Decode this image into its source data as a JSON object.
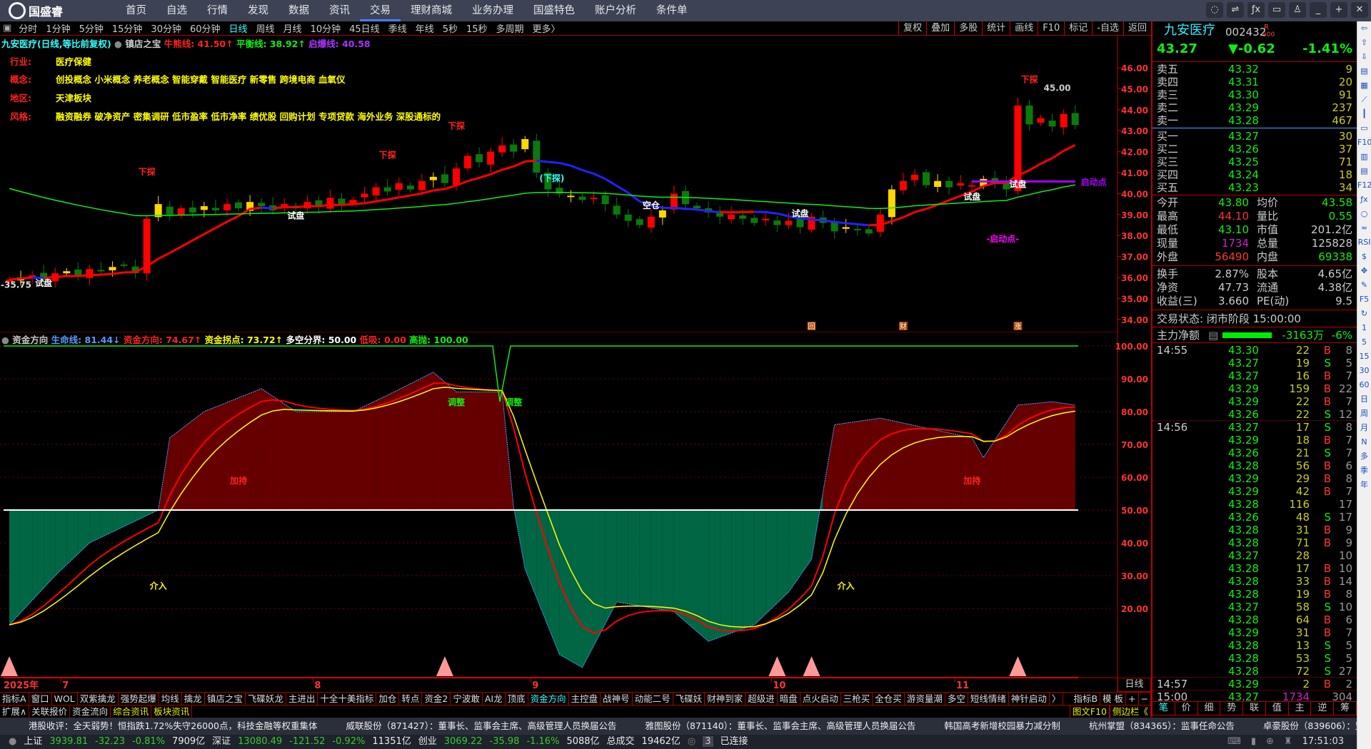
{
  "app": {
    "logo_text": "国盛睿"
  },
  "nav": [
    "首页",
    "自选",
    "行情",
    "发现",
    "数据",
    "资讯",
    "交易",
    "理财商城",
    "业务办理",
    "国盛特色",
    "账户分析",
    "条件单"
  ],
  "nav_active": 6,
  "window_buttons": [
    "chat-icon",
    "settings-icon",
    "fx-icon",
    "screen-icon",
    "skin-icon",
    "minimize-icon",
    "restore-icon",
    "close-icon"
  ],
  "periods": [
    "分时",
    "1分钟",
    "5分钟",
    "15分钟",
    "30分钟",
    "60分钟",
    "日线",
    "周线",
    "月线",
    "10分钟",
    "45日线",
    "季线",
    "年线",
    "5秒",
    "15秒",
    "多周期",
    "更多〉"
  ],
  "period_active": 6,
  "chart_tools": [
    "复权",
    "叠加",
    "多股",
    "统计",
    "画线",
    "F10",
    "标记",
    "-自选",
    "返回"
  ],
  "main_header": {
    "title": "九安医疗(日线,等比前复权)",
    "indicator": "镇店之宝",
    "bull_label": "牛熊线: 41.50↑",
    "balance_label": "平衡线: 38.92↑",
    "burst_label": "启爆线: 40.58"
  },
  "info": [
    {
      "k": "行业:",
      "v": "医疗保健"
    },
    {
      "k": "概念:",
      "v": "创投概念 小米概念 养老概念 智能穿戴 智能医疗 新零售 跨境电商 血氧仪"
    },
    {
      "k": "地区:",
      "v": "天津板块"
    },
    {
      "k": "风格:",
      "v": "融资融券 破净资产 密集调研 低市盈率 低市净率 绩优股 回购计划 专项贷款 海外业务 深股通标的"
    }
  ],
  "price_axis": [
    "46.00",
    "45.00",
    "44.00",
    "43.00",
    "42.00",
    "41.00",
    "40.00",
    "39.00",
    "38.00",
    "37.00",
    "36.00",
    "35.00",
    "34.00"
  ],
  "chart_data": {
    "type": "candlestick",
    "closes": [
      35.9,
      36.0,
      36.1,
      35.9,
      36.2,
      36.3,
      36.1,
      36.4,
      36.3,
      36.5,
      36.6,
      36.2,
      38.8,
      39.5,
      39.0,
      39.3,
      39.1,
      39.4,
      39.2,
      39.5,
      39.3,
      39.6,
      39.4,
      39.2,
      39.5,
      39.3,
      39.6,
      39.4,
      39.8,
      39.5,
      39.7,
      40.0,
      40.3,
      40.1,
      40.5,
      40.2,
      40.6,
      40.8,
      40.5,
      41.2,
      41.8,
      41.5,
      42.0,
      42.3,
      42.0,
      42.6,
      41.0,
      40.2,
      40.0,
      39.9,
      39.7,
      39.8,
      39.5,
      39.0,
      38.7,
      38.5,
      38.9,
      39.2,
      40.0,
      39.5,
      39.3,
      39.1,
      38.9,
      39.0,
      38.8,
      38.6,
      38.8,
      38.5,
      38.7,
      38.4,
      38.9,
      38.6,
      38.2,
      38.4,
      38.3,
      38.1,
      39.0,
      40.2,
      40.6,
      40.9,
      40.4,
      40.6,
      40.3,
      40.5,
      40.4,
      40.7,
      40.5,
      40.2,
      44.2,
      43.3,
      43.6,
      43.2,
      43.8,
      43.27
    ],
    "first_open": 35.8,
    "price_range": [
      33.6,
      46.4
    ],
    "launch_line": {
      "value": 40.58,
      "from": 84,
      "to": 93,
      "label": "启动点"
    },
    "annotations": [
      {
        "i": 0,
        "p": 35.5,
        "t": "-35.75",
        "c": "#ddd"
      },
      {
        "i": 3,
        "p": 35.6,
        "t": "试盘",
        "c": "#fff"
      },
      {
        "i": 12,
        "p": 40.9,
        "t": "下探",
        "c": "#f22"
      },
      {
        "i": 25,
        "p": 38.8,
        "t": "试盘",
        "c": "#fff"
      },
      {
        "i": 33,
        "p": 41.7,
        "t": "下探",
        "c": "#f22"
      },
      {
        "i": 39,
        "p": 43.1,
        "t": "下探",
        "c": "#f22"
      },
      {
        "i": 47,
        "p": 40.6,
        "t": "(下探)",
        "c": "#3ff"
      },
      {
        "i": 56,
        "p": 39.3,
        "t": "空仓",
        "c": "#fff"
      },
      {
        "i": 69,
        "p": 38.9,
        "t": "试盘",
        "c": "#fff"
      },
      {
        "i": 84,
        "p": 39.7,
        "t": "试盘",
        "c": "#fff"
      },
      {
        "i": 88,
        "p": 40.3,
        "t": "试盘",
        "c": "#fff"
      },
      {
        "i": 89,
        "p": 45.3,
        "t": "下探",
        "c": "#f22"
      },
      {
        "i": 91,
        "p": 44.9,
        "t": "45.00",
        "c": "#ccc"
      },
      {
        "i": 86,
        "p": 37.7,
        "t": "-启动点-",
        "c": "#f0f"
      }
    ],
    "event_markers": [
      {
        "i": 70,
        "t": "回"
      },
      {
        "i": 78,
        "t": "财"
      },
      {
        "i": 88,
        "t": "涨"
      }
    ]
  },
  "indicator": {
    "name": "资金方向",
    "life_label": "生命线: 81.44↓",
    "dir_label": "资金方向: 74.67↑",
    "turn_label": "资金拐点: 73.72↑",
    "split_label": "多空分界: 50.00",
    "low_label": "低吸: 0.00",
    "high_label": "高抛: 100.00",
    "axis": [
      "100.00",
      "90.00",
      "80.00",
      "70.00",
      "60.00",
      "50.00",
      "40.00",
      "30.00",
      "20.00"
    ],
    "fund_keyframes": [
      [
        0,
        15
      ],
      [
        4,
        30
      ],
      [
        7,
        40
      ],
      [
        13,
        50
      ],
      [
        14,
        72
      ],
      [
        17,
        80
      ],
      [
        22,
        87
      ],
      [
        25,
        80
      ],
      [
        30,
        80
      ],
      [
        33,
        85
      ],
      [
        37,
        92
      ],
      [
        39,
        86
      ],
      [
        43,
        86
      ],
      [
        44,
        51
      ],
      [
        45,
        32
      ],
      [
        48,
        6
      ],
      [
        50,
        2
      ],
      [
        53,
        22
      ],
      [
        58,
        19
      ],
      [
        61,
        10
      ],
      [
        65,
        15
      ],
      [
        68,
        25
      ],
      [
        70,
        35
      ],
      [
        72,
        76
      ],
      [
        76,
        78
      ],
      [
        80,
        75
      ],
      [
        84,
        72
      ],
      [
        85,
        66
      ],
      [
        88,
        82
      ],
      [
        91,
        83
      ],
      [
        93,
        82
      ]
    ],
    "signals": [
      {
        "i": 13,
        "v": 26,
        "t": "介入"
      },
      {
        "i": 20,
        "v": 58,
        "t": "加持"
      },
      {
        "i": 39,
        "v": 82,
        "t": "调整"
      },
      {
        "i": 44,
        "v": 82,
        "t": "调整"
      },
      {
        "i": 73,
        "v": 26,
        "t": "介入"
      },
      {
        "i": 84,
        "v": 58,
        "t": "加持"
      }
    ],
    "triangles": [
      0,
      38,
      67,
      70,
      88
    ]
  },
  "date_axis": [
    {
      "i": 0,
      "t": "2025年"
    },
    {
      "i": 5,
      "t": "7"
    },
    {
      "i": 27,
      "t": "8"
    },
    {
      "i": 46,
      "t": "9"
    },
    {
      "i": 67,
      "t": "10"
    },
    {
      "i": 83,
      "t": "11"
    }
  ],
  "period_box": "日线",
  "indicator_tabs": [
    "指标A",
    "窗口",
    "WOL",
    "双紫擒龙",
    "强势起爆",
    "均线",
    "擒龙",
    "镇店之宝",
    "飞碟妖龙",
    "主进出",
    "十全十美指标",
    "加仓",
    "转点",
    "资金2",
    "宁波敢",
    "AI龙",
    "顶底",
    "资金方向",
    "主控盘",
    "战神号",
    "动能二号",
    "飞碟妖",
    "财神到家",
    "超级进",
    "暗盘",
    "点火启动",
    "三枪买",
    "全仓买",
    "游资量潮",
    "多空",
    "短线情绪",
    "神针启动",
    "〉"
  ],
  "indicator_tab_active": 17,
  "indicator_tools": [
    "指标B",
    "模 板",
    "+",
    "−"
  ],
  "ext_tabs": [
    "扩展∧",
    "关联报价",
    "资金流向",
    "综合资讯",
    "板块资讯"
  ],
  "ext_right": [
    "图文F10",
    "侧边栏《"
  ],
  "quote": {
    "name": "九安医疗",
    "code": "002432",
    "badge_top": "R",
    "badge_bottom": "500",
    "price": "43.27",
    "change": "▼-0.62",
    "pct": "-1.41%",
    "sells": [
      {
        "l": "卖五",
        "p": "43.32",
        "v": "9"
      },
      {
        "l": "卖四",
        "p": "43.31",
        "v": "20"
      },
      {
        "l": "卖三",
        "p": "43.30",
        "v": "91"
      },
      {
        "l": "卖二",
        "p": "43.29",
        "v": "237"
      },
      {
        "l": "卖一",
        "p": "43.28",
        "v": "467"
      }
    ],
    "buys": [
      {
        "l": "买一",
        "p": "43.27",
        "v": "30"
      },
      {
        "l": "买二",
        "p": "43.26",
        "v": "37"
      },
      {
        "l": "买三",
        "p": "43.25",
        "v": "71"
      },
      {
        "l": "买四",
        "p": "43.24",
        "v": "18"
      },
      {
        "l": "买五",
        "p": "43.23",
        "v": "34"
      }
    ],
    "stats": [
      {
        "k1": "今开",
        "v1": "43.80",
        "c1": "#1e1",
        "k2": "均价",
        "v2": "43.58",
        "c2": "#1e1"
      },
      {
        "k1": "最高",
        "v1": "44.10",
        "c1": "#f33",
        "k2": "量比",
        "v2": "0.55",
        "c2": "#1e1"
      },
      {
        "k1": "最低",
        "v1": "43.10",
        "c1": "#1e1",
        "k2": "市值",
        "v2": "201.2亿",
        "c2": "#ccc"
      },
      {
        "k1": "现量",
        "v1": "1734",
        "c1": "#c2c",
        "k2": "总量",
        "v2": "125828",
        "c2": "#ccc"
      },
      {
        "k1": "外盘",
        "v1": "56490",
        "c1": "#f33",
        "k2": "内盘",
        "v2": "69338",
        "c2": "#1e1"
      }
    ],
    "stats2": [
      {
        "k1": "换手",
        "v1": "2.87%",
        "k2": "股本",
        "v2": "4.65亿"
      },
      {
        "k1": "净资",
        "v1": "47.73",
        "k2": "流通",
        "v2": "4.38亿"
      },
      {
        "k1": "收益(三)",
        "v1": "3.660",
        "k2": "PE(动)",
        "v2": "9.5"
      }
    ],
    "trade_state": "交易状态: 闭市阶段 15:00:00",
    "main_flow_label": "主力净额",
    "main_flow_value": "-3163万",
    "main_flow_pct": "-6%",
    "main_flow_fill": 0.6
  },
  "trades": [
    {
      "t": "14:55",
      "p": "43.30",
      "v": "22",
      "d": "B",
      "n": "8"
    },
    {
      "t": "",
      "p": "43.27",
      "v": "19",
      "d": "S",
      "n": "5"
    },
    {
      "t": "",
      "p": "43.27",
      "v": "16",
      "d": "B",
      "n": "7"
    },
    {
      "t": "",
      "p": "43.29",
      "v": "159",
      "d": "B",
      "n": "22"
    },
    {
      "t": "",
      "p": "43.29",
      "v": "22",
      "d": "B",
      "n": "7"
    },
    {
      "t": "",
      "p": "43.26",
      "v": "22",
      "d": "S",
      "n": "12"
    },
    {
      "t": "14:56",
      "p": "43.27",
      "v": "17",
      "d": "S",
      "n": "8"
    },
    {
      "t": "",
      "p": "43.29",
      "v": "18",
      "d": "B",
      "n": "7"
    },
    {
      "t": "",
      "p": "43.26",
      "v": "21",
      "d": "S",
      "n": "7"
    },
    {
      "t": "",
      "p": "43.28",
      "v": "56",
      "d": "B",
      "n": "6"
    },
    {
      "t": "",
      "p": "43.29",
      "v": "29",
      "d": "B",
      "n": "8"
    },
    {
      "t": "",
      "p": "43.29",
      "v": "42",
      "d": "B",
      "n": "7"
    },
    {
      "t": "",
      "p": "43.28",
      "v": "116",
      "d": "",
      "n": "17"
    },
    {
      "t": "",
      "p": "43.26",
      "v": "48",
      "d": "S",
      "n": "17"
    },
    {
      "t": "",
      "p": "43.28",
      "v": "31",
      "d": "B",
      "n": "9"
    },
    {
      "t": "",
      "p": "43.28",
      "v": "71",
      "d": "B",
      "n": "9"
    },
    {
      "t": "",
      "p": "43.27",
      "v": "28",
      "d": "",
      "n": "10"
    },
    {
      "t": "",
      "p": "43.28",
      "v": "17",
      "d": "B",
      "n": "10"
    },
    {
      "t": "",
      "p": "43.28",
      "v": "33",
      "d": "B",
      "n": "14"
    },
    {
      "t": "",
      "p": "43.28",
      "v": "19",
      "d": "B",
      "n": "8"
    },
    {
      "t": "",
      "p": "43.27",
      "v": "58",
      "d": "S",
      "n": "10"
    },
    {
      "t": "",
      "p": "43.28",
      "v": "64",
      "d": "B",
      "n": "6"
    },
    {
      "t": "",
      "p": "43.29",
      "v": "31",
      "d": "B",
      "n": "7"
    },
    {
      "t": "",
      "p": "43.28",
      "v": "13",
      "d": "S",
      "n": "5"
    },
    {
      "t": "",
      "p": "43.28",
      "v": "53",
      "d": "S",
      "n": "5"
    },
    {
      "t": "",
      "p": "43.28",
      "v": "72",
      "d": "S",
      "n": "27"
    },
    {
      "t": "14:57",
      "p": "43.29",
      "v": "2",
      "d": "B",
      "n": "2"
    },
    {
      "t": "15:00",
      "p": "43.27",
      "v": "1734",
      "d": "",
      "n": "304"
    }
  ],
  "panel_tabs": [
    "笔",
    "价",
    "细",
    "势",
    "联",
    "值",
    "主",
    "逆",
    "筹"
  ],
  "sidebar": [
    "⇦",
    "⇧",
    "⇩",
    "▤",
    "▦",
    "⟋",
    "┃",
    "▭",
    "F10",
    "▥",
    "▤",
    "F12",
    "ƒx",
    "○",
    "≈",
    "RSI",
    "$",
    "✥",
    "✎",
    "F5",
    "↻",
    "1",
    "5",
    "15",
    "30",
    "60",
    "日",
    "周",
    "月",
    "N",
    "多",
    "季",
    "年"
  ],
  "news": [
    "港股收评：全天弱势！恒指跌1.72%失守26000点，科技金融等权重集体",
    "威联股份（871427）：董事长、监事会主席、高级管理人员换届公告",
    "雅图股份（871140）：董事长、监事会主席、高级管理人员换届公告",
    "韩国高考新增校园暴力减分制",
    "杭州掌盟（834365）：监事任命公告",
    "卓豪股份（839606）：监事任命公告"
  ],
  "status": {
    "sh": {
      "l": "上证",
      "p": "3939.81",
      "c": "-32.23",
      "pct": "-0.81%",
      "a": "7909亿"
    },
    "sz": {
      "l": "深证",
      "p": "13080.49",
      "c": "-121.52",
      "pct": "-0.92%",
      "a": "11351亿"
    },
    "cy": {
      "l": "创业",
      "p": "3069.22",
      "c": "-35.98",
      "pct": "-1.16%",
      "a": "5088亿"
    },
    "total_label": "总成交",
    "total": "19462亿",
    "conn_count": "3",
    "conn": "已连接",
    "time": "17:51:03"
  }
}
